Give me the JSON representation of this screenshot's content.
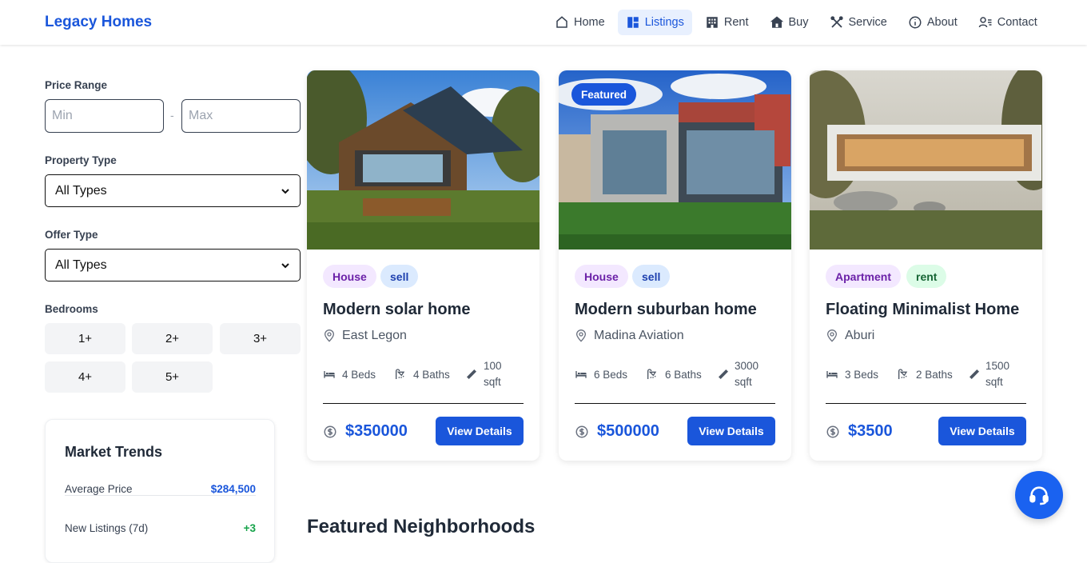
{
  "brand": "Legacy Homes",
  "nav": [
    {
      "label": "Home",
      "icon": "home-icon"
    },
    {
      "label": "Listings",
      "icon": "grid-icon",
      "active": true
    },
    {
      "label": "Rent",
      "icon": "building-icon"
    },
    {
      "label": "Buy",
      "icon": "store-icon"
    },
    {
      "label": "Service",
      "icon": "tools-icon"
    },
    {
      "label": "About",
      "icon": "info-icon"
    },
    {
      "label": "Contact",
      "icon": "contact-icon"
    }
  ],
  "filters": {
    "price_label": "Price Range",
    "min_placeholder": "Min",
    "max_placeholder": "Max",
    "dash": "-",
    "property_type_label": "Property Type",
    "property_type_value": "All Types",
    "offer_type_label": "Offer Type",
    "offer_type_value": "All Types",
    "bedrooms_label": "Bedrooms",
    "bedrooms": [
      "1+",
      "2+",
      "3+",
      "4+",
      "5+"
    ]
  },
  "market": {
    "title": "Market Trends",
    "rows": [
      {
        "label": "Average Price",
        "value": "$284,500",
        "color": "#1a56db"
      },
      {
        "label": "New Listings (7d)",
        "value": "+3",
        "color": "#16a34a"
      }
    ]
  },
  "listings": [
    {
      "featured": false,
      "type": "House",
      "offer": "sell",
      "title": "Modern solar home",
      "location": "East Legon",
      "beds": "4 Beds",
      "baths": "4 Baths",
      "area_num": "100",
      "area_unit": "sqft",
      "price": "$350000",
      "button": "View Details"
    },
    {
      "featured": true,
      "featured_label": "Featured",
      "type": "House",
      "offer": "sell",
      "title": "Modern suburban home",
      "location": "Madina Aviation",
      "beds": "6 Beds",
      "baths": "6 Baths",
      "area_num": "3000",
      "area_unit": "sqft",
      "price": "$500000",
      "button": "View Details"
    },
    {
      "featured": false,
      "type": "Apartment",
      "offer": "rent",
      "title": "Floating Minimalist Home",
      "location": "Aburi",
      "beds": "3 Beds",
      "baths": "2 Baths",
      "area_num": "1500",
      "area_unit": "sqft",
      "price": "$3500",
      "button": "View Details"
    }
  ],
  "section_title": "Featured Neighborhoods",
  "colors": {
    "accent": "#1a56db",
    "house_badge_bg": "#f3e8ff",
    "house_badge_text": "#6b21a8",
    "sell_badge_bg": "#dbeafe",
    "sell_badge_text": "#1e40af",
    "rent_badge_bg": "#dcfce7",
    "rent_badge_text": "#166534"
  }
}
